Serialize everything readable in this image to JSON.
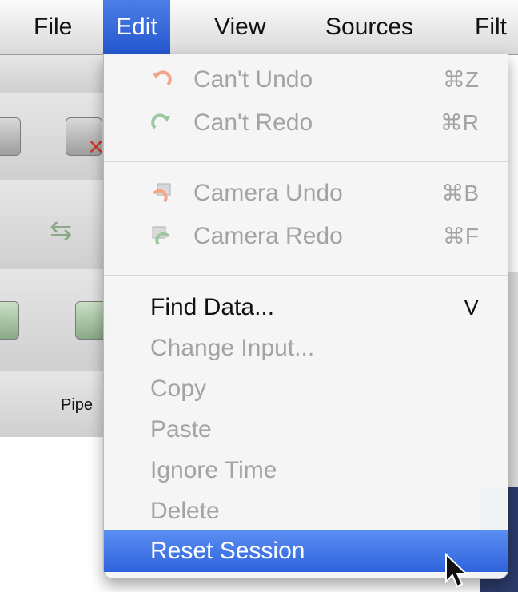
{
  "menubar": {
    "items": [
      "File",
      "Edit",
      "View",
      "Sources",
      "Filt"
    ]
  },
  "background": {
    "panel_label": "Pipe"
  },
  "edit_menu": {
    "undo": {
      "label": "Can't Undo",
      "shortcut": "⌘Z"
    },
    "redo": {
      "label": "Can't Redo",
      "shortcut": "⌘R"
    },
    "camera_undo": {
      "label": "Camera Undo",
      "shortcut": "⌘B"
    },
    "camera_redo": {
      "label": "Camera Redo",
      "shortcut": "⌘F"
    },
    "find_data": {
      "label": "Find Data...",
      "shortcut": "V"
    },
    "change_input": {
      "label": "Change Input..."
    },
    "copy": {
      "label": "Copy"
    },
    "paste": {
      "label": "Paste"
    },
    "ignore_time": {
      "label": "Ignore Time"
    },
    "delete": {
      "label": "Delete"
    },
    "reset_session": {
      "label": "Reset Session"
    }
  },
  "colors": {
    "highlight": "#2f63dd",
    "disabled_text": "#a3a3a3"
  }
}
